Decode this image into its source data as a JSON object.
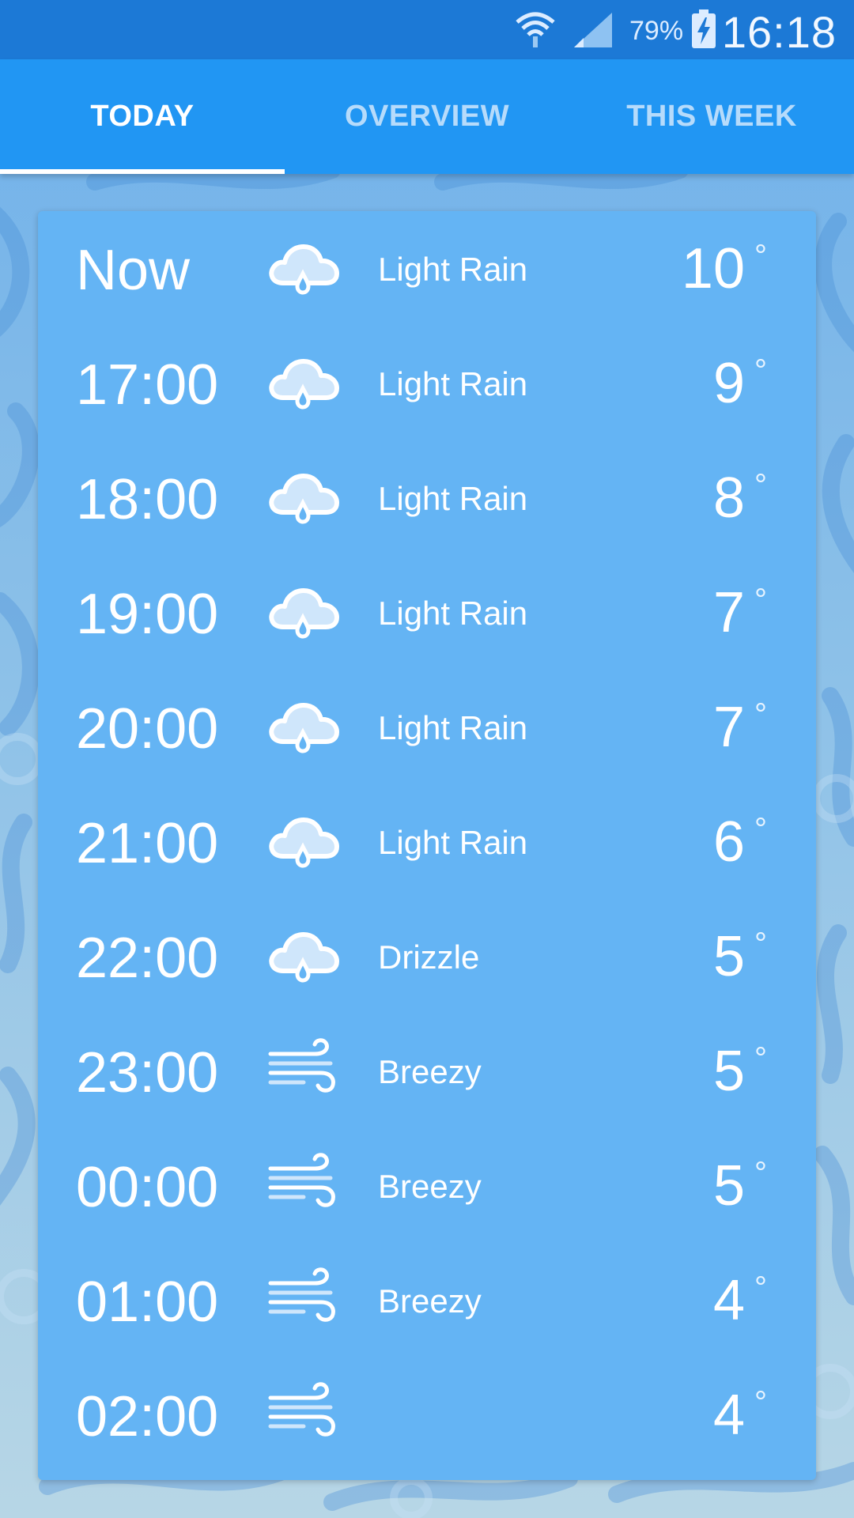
{
  "status_bar": {
    "battery_percent": "79%",
    "time": "16:18",
    "icons": [
      "wifi-icon",
      "signal-icon",
      "battery-charging-icon"
    ]
  },
  "tabs": [
    {
      "label": "TODAY",
      "active": true
    },
    {
      "label": "OVERVIEW",
      "active": false
    },
    {
      "label": "THIS WEEK",
      "active": false
    }
  ],
  "hourly": [
    {
      "time": "Now",
      "icon": "rain-cloud-icon",
      "condition": "Light Rain",
      "temp": "10",
      "deg": "°"
    },
    {
      "time": "17:00",
      "icon": "rain-cloud-icon",
      "condition": "Light Rain",
      "temp": "9",
      "deg": "°"
    },
    {
      "time": "18:00",
      "icon": "rain-cloud-icon",
      "condition": "Light Rain",
      "temp": "8",
      "deg": "°"
    },
    {
      "time": "19:00",
      "icon": "rain-cloud-icon",
      "condition": "Light Rain",
      "temp": "7",
      "deg": "°"
    },
    {
      "time": "20:00",
      "icon": "rain-cloud-icon",
      "condition": "Light Rain",
      "temp": "7",
      "deg": "°"
    },
    {
      "time": "21:00",
      "icon": "rain-cloud-icon",
      "condition": "Light Rain",
      "temp": "6",
      "deg": "°"
    },
    {
      "time": "22:00",
      "icon": "rain-cloud-icon",
      "condition": "Drizzle",
      "temp": "5",
      "deg": "°"
    },
    {
      "time": "23:00",
      "icon": "wind-icon",
      "condition": "Breezy",
      "temp": "5",
      "deg": "°"
    },
    {
      "time": "00:00",
      "icon": "wind-icon",
      "condition": "Breezy",
      "temp": "5",
      "deg": "°"
    },
    {
      "time": "01:00",
      "icon": "wind-icon",
      "condition": "Breezy",
      "temp": "4",
      "deg": "°"
    },
    {
      "time": "02:00",
      "icon": "wind-icon",
      "condition": "",
      "temp": "4",
      "deg": "°"
    }
  ],
  "colors": {
    "status_bar": "#1c79d6",
    "tab_bar": "#2196f3",
    "card": "#64b4f4",
    "tab_inactive_text": "#b6dbfb"
  }
}
